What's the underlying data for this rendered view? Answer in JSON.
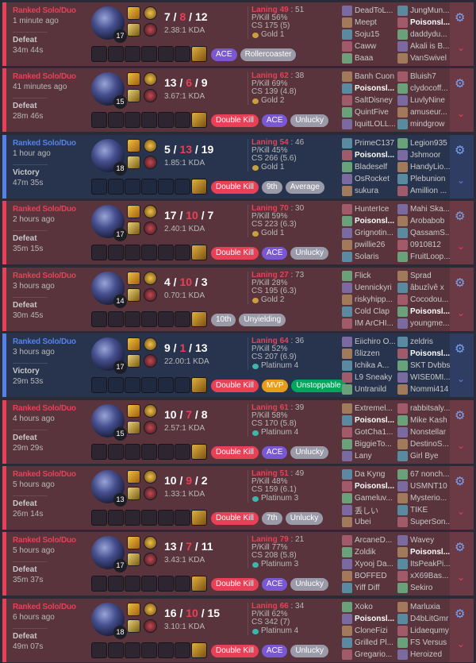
{
  "matches": [
    {
      "result": "loss",
      "queue": "Ranked Solo/Duo",
      "ago": "1 minute ago",
      "outcome": "Defeat",
      "duration": "34m 44s",
      "level": "17",
      "kda": {
        "k": "7",
        "d": "8",
        "a": "12"
      },
      "ratio": "2.38:1 KDA",
      "laning_label": "Laning",
      "laning_me": "49",
      "laning_opp": "51",
      "pkill": "P/Kill 56%",
      "cs": "CS 175 (5)",
      "rank": "Gold 1",
      "badges": [
        {
          "label": "ACE",
          "kind": "b-ace"
        },
        {
          "label": "Rollercoaster",
          "kind": "b-grey"
        }
      ],
      "team1": [
        "DeadToL...",
        "Meept",
        "Soju15",
        "Caww",
        "Baaa"
      ],
      "team2": [
        "JungMun...",
        "Poisonsl...",
        "daddydu...",
        "Akali is B...",
        "VanSwivel"
      ],
      "me_team": 2,
      "me_idx": 1
    },
    {
      "result": "loss",
      "queue": "Ranked Solo/Duo",
      "ago": "41 minutes ago",
      "outcome": "Defeat",
      "duration": "28m 46s",
      "level": "15",
      "kda": {
        "k": "13",
        "d": "6",
        "a": "9"
      },
      "ratio": "3.67:1 KDA",
      "laning_label": "Laning",
      "laning_me": "62",
      "laning_opp": "38",
      "pkill": "P/Kill 69%",
      "cs": "CS 139 (4.8)",
      "rank": "Gold 2",
      "badges": [
        {
          "label": "Double Kill",
          "kind": "b-double"
        },
        {
          "label": "ACE",
          "kind": "b-ace"
        },
        {
          "label": "Unlucky",
          "kind": "b-grey"
        }
      ],
      "team1": [
        "Banh Cuon",
        "Poisonsl...",
        "SaltDisney",
        "QuintFive",
        "IquitLOLL..."
      ],
      "team2": [
        "Bluish7",
        "clydocoff...",
        "LuvlyNine",
        "amuseur...",
        "mindgrow"
      ],
      "me_team": 1,
      "me_idx": 1
    },
    {
      "result": "win",
      "queue": "Ranked Solo/Duo",
      "ago": "1 hour ago",
      "outcome": "Victory",
      "duration": "47m 35s",
      "level": "18",
      "kda": {
        "k": "5",
        "d": "13",
        "a": "19"
      },
      "ratio": "1.85:1 KDA",
      "laning_label": "Laning",
      "laning_me": "54",
      "laning_opp": "46",
      "pkill": "P/Kill 45%",
      "cs": "CS 266 (5.6)",
      "rank": "Gold 1",
      "badges": [
        {
          "label": "Double Kill",
          "kind": "b-double"
        },
        {
          "label": "9th",
          "kind": "b-grey"
        },
        {
          "label": "Average",
          "kind": "b-grey"
        }
      ],
      "team1": [
        "PrimeC137",
        "Poisonsl...",
        "Bladeself",
        "OsRocket",
        "sukura"
      ],
      "team2": [
        "Legion935",
        "Jshmoor",
        "HandyLio...",
        "Plebunion",
        "Amillion ..."
      ],
      "me_team": 1,
      "me_idx": 1
    },
    {
      "result": "loss",
      "queue": "Ranked Solo/Duo",
      "ago": "2 hours ago",
      "outcome": "Defeat",
      "duration": "35m 15s",
      "level": "17",
      "kda": {
        "k": "17",
        "d": "10",
        "a": "7"
      },
      "ratio": "2.40:1 KDA",
      "laning_label": "Laning",
      "laning_me": "70",
      "laning_opp": "30",
      "pkill": "P/Kill 59%",
      "cs": "CS 223 (6.3)",
      "rank": "Gold 1",
      "badges": [
        {
          "label": "Double Kill",
          "kind": "b-double"
        },
        {
          "label": "ACE",
          "kind": "b-ace"
        },
        {
          "label": "Unlucky",
          "kind": "b-grey"
        }
      ],
      "team1": [
        "HunterIce",
        "Poisonsl...",
        "Grignotin...",
        "pwillie26",
        "Solaris"
      ],
      "team2": [
        "Mahi Ska...",
        "Arobabob",
        "QassamS...",
        "0910812",
        "FruitLoop..."
      ],
      "me_team": 1,
      "me_idx": 1
    },
    {
      "result": "loss",
      "queue": "Ranked Solo/Duo",
      "ago": "3 hours ago",
      "outcome": "Defeat",
      "duration": "30m 45s",
      "level": "14",
      "kda": {
        "k": "4",
        "d": "10",
        "a": "3"
      },
      "ratio": "0.70:1 KDA",
      "laning_label": "Laning",
      "laning_me": "27",
      "laning_opp": "73",
      "pkill": "P/Kill 28%",
      "cs": "CS 195 (6.3)",
      "rank": "Gold 2",
      "badges": [
        {
          "label": "10th",
          "kind": "b-grey"
        },
        {
          "label": "Unyielding",
          "kind": "b-grey"
        }
      ],
      "team1": [
        "Flick",
        "Uennickyri",
        "riskyhipp...",
        "Cold Clap",
        "IM ArCHI..."
      ],
      "team2": [
        "Sprad",
        "âbuzîvê x",
        "Cocodou...",
        "Poisonsl...",
        "youngme..."
      ],
      "me_team": 2,
      "me_idx": 3
    },
    {
      "result": "win",
      "queue": "Ranked Solo/Duo",
      "ago": "3 hours ago",
      "outcome": "Victory",
      "duration": "29m 53s",
      "level": "17",
      "kda": {
        "k": "9",
        "d": "1",
        "a": "13"
      },
      "ratio": "22.00:1 KDA",
      "laning_label": "Laning",
      "laning_me": "64",
      "laning_opp": "36",
      "pkill": "P/Kill 52%",
      "cs": "CS 207 (6.9)",
      "rank": "Platinum 4",
      "badges": [
        {
          "label": "Double Kill",
          "kind": "b-double"
        },
        {
          "label": "MVP",
          "kind": "b-mvp"
        },
        {
          "label": "Unstoppable",
          "kind": "b-unstop"
        }
      ],
      "team1": [
        "Eiichiro O...",
        "ßlizzen",
        "Ichika A...",
        "L9 Sneaky",
        "Untranild"
      ],
      "team2": [
        "zeldris",
        "Poisonsl...",
        "SKT Dvbbs",
        "WISE0MI...",
        "Nommi414"
      ],
      "me_team": 2,
      "me_idx": 1
    },
    {
      "result": "loss",
      "queue": "Ranked Solo/Duo",
      "ago": "4 hours ago",
      "outcome": "Defeat",
      "duration": "29m 29s",
      "level": "15",
      "kda": {
        "k": "10",
        "d": "7",
        "a": "8"
      },
      "ratio": "2.57:1 KDA",
      "laning_label": "Laning",
      "laning_me": "61",
      "laning_opp": "39",
      "pkill": "P/Kill 58%",
      "cs": "CS 170 (5.8)",
      "rank": "Platinum 4",
      "badges": [
        {
          "label": "Double Kill",
          "kind": "b-double"
        },
        {
          "label": "ACE",
          "kind": "b-ace"
        },
        {
          "label": "Unlucky",
          "kind": "b-grey"
        }
      ],
      "team1": [
        "Extremel...",
        "Poisonsl...",
        "GotCha1...",
        "BiggieTo...",
        "Lany"
      ],
      "team2": [
        "rabbitsaly...",
        "Mike Kash",
        "Nonstellar",
        "DestinoS...",
        "Girl Bye"
      ],
      "me_team": 1,
      "me_idx": 1
    },
    {
      "result": "loss",
      "queue": "Ranked Solo/Duo",
      "ago": "5 hours ago",
      "outcome": "Defeat",
      "duration": "26m 14s",
      "level": "13",
      "kda": {
        "k": "10",
        "d": "9",
        "a": "2"
      },
      "ratio": "1.33:1 KDA",
      "laning_label": "Laning",
      "laning_me": "51",
      "laning_opp": "49",
      "pkill": "P/Kill 48%",
      "cs": "CS 159 (6.1)",
      "rank": "Platinum 3",
      "badges": [
        {
          "label": "Double Kill",
          "kind": "b-double"
        },
        {
          "label": "7th",
          "kind": "b-grey"
        },
        {
          "label": "Unlucky",
          "kind": "b-grey"
        }
      ],
      "team1": [
        "Da Kyng",
        "Poisonsl...",
        "Gameluv...",
        "丢しい",
        "Ubei"
      ],
      "team2": [
        "67 nonch...",
        "USMNT10",
        "Mysterio...",
        "TIKE",
        "SuperSon..."
      ],
      "me_team": 1,
      "me_idx": 1
    },
    {
      "result": "loss",
      "queue": "Ranked Solo/Duo",
      "ago": "5 hours ago",
      "outcome": "Defeat",
      "duration": "35m 37s",
      "level": "17",
      "kda": {
        "k": "13",
        "d": "7",
        "a": "11"
      },
      "ratio": "3.43:1 KDA",
      "laning_label": "Laning",
      "laning_me": "79",
      "laning_opp": "21",
      "pkill": "P/Kill 77%",
      "cs": "CS 208 (5.8)",
      "rank": "Platinum 3",
      "badges": [
        {
          "label": "Double Kill",
          "kind": "b-double"
        },
        {
          "label": "ACE",
          "kind": "b-ace"
        },
        {
          "label": "Unlucky",
          "kind": "b-grey"
        }
      ],
      "team1": [
        "ArcaneD...",
        "Zoldik",
        "Xyooj Da...",
        "BOFFED",
        "Yiff Diff"
      ],
      "team2": [
        "Wavey",
        "Poisonsl...",
        "ItsPeakPi...",
        "xX69Bas...",
        "Sekiro"
      ],
      "me_team": 2,
      "me_idx": 1
    },
    {
      "result": "loss",
      "queue": "Ranked Solo/Duo",
      "ago": "6 hours ago",
      "outcome": "Defeat",
      "duration": "49m 07s",
      "level": "18",
      "kda": {
        "k": "16",
        "d": "10",
        "a": "15"
      },
      "ratio": "3.10:1 KDA",
      "laning_label": "Laning",
      "laning_me": "66",
      "laning_opp": "34",
      "pkill": "P/Kill 62%",
      "cs": "CS 342 (7)",
      "rank": "Platinum 4",
      "badges": [
        {
          "label": "Double Kill",
          "kind": "b-double"
        },
        {
          "label": "ACE",
          "kind": "b-ace"
        },
        {
          "label": "Unlucky",
          "kind": "b-grey"
        }
      ],
      "team1": [
        "Xoko",
        "Poisonsl...",
        "CloneFizi",
        "Grilled Pl...",
        "Gregario..."
      ],
      "team2": [
        "Marluxia",
        "D4bLitGmr",
        "Lidaequmy",
        "FS Versus",
        "Heroized"
      ],
      "me_team": 1,
      "me_idx": 1
    }
  ],
  "icons": {
    "settings": "gear-icon",
    "expand": "chevron-down-icon"
  },
  "colors": {
    "loss": "#e84057",
    "win": "#5383e8",
    "loss_bg": "#59343d",
    "win_bg": "#28344e"
  }
}
